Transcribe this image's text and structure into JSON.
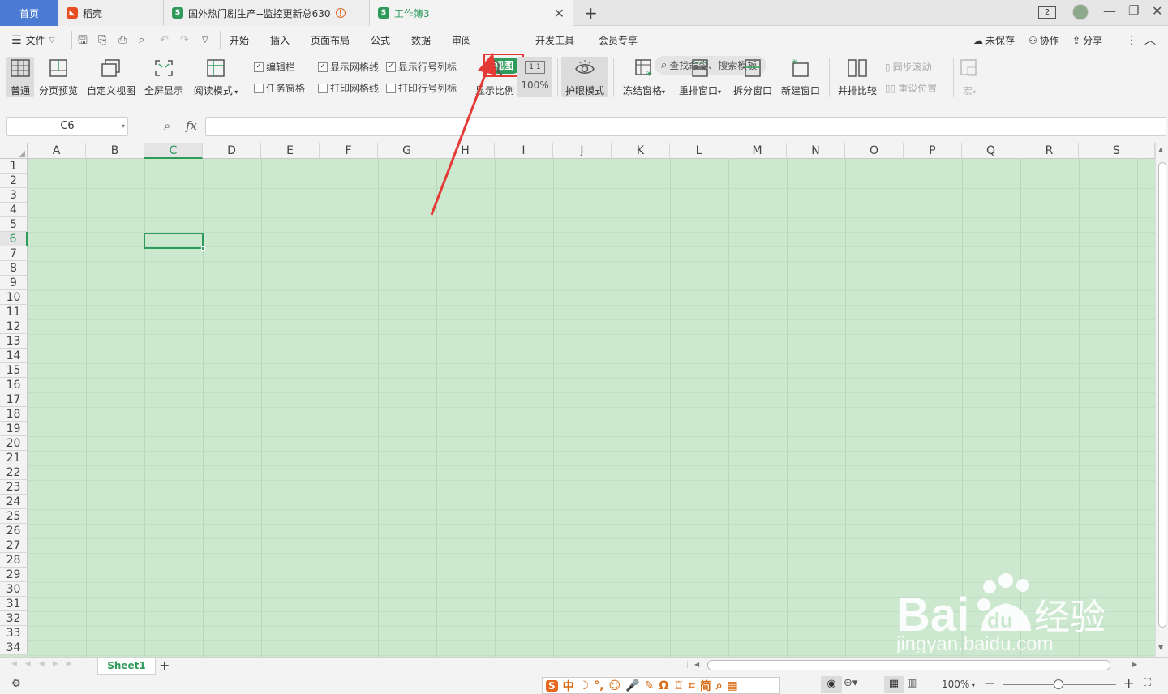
{
  "tabs": {
    "home": "首页",
    "daoke": "稻壳",
    "doc1": "国外热门剧生产--监控更新总630",
    "active": "工作簿3",
    "new_tab": "+"
  },
  "window": {
    "count_badge": "2"
  },
  "menu": {
    "file": "文件",
    "tabs": [
      "开始",
      "插入",
      "页面布局",
      "公式",
      "数据",
      "审阅",
      "视图",
      "开发工具",
      "会员专享"
    ],
    "search_placeholder": "查找命令、搜索模板",
    "unsaved": "未保存",
    "collab": "协作",
    "share": "分享"
  },
  "ribbon": {
    "normal": "普通",
    "page_break": "分页预览",
    "custom_view": "自定义视图",
    "full_screen": "全屏显示",
    "read_mode": "阅读模式",
    "edit_bar": "编辑栏",
    "task_pane": "任务窗格",
    "show_gridlines": "显示网格线",
    "print_gridlines": "打印网格线",
    "show_headers": "显示行号列标",
    "print_headers": "打印行号列标",
    "zoom": "显示比例",
    "zoom100": "100%",
    "zoom_icon": "1:1",
    "eye_mode": "护眼模式",
    "freeze": "冻结窗格",
    "arrange": "重排窗口",
    "split": "拆分窗口",
    "new_window": "新建窗口",
    "side_by_side": "并排比较",
    "sync_scroll": "同步滚动",
    "reset_pos": "重设位置",
    "macro": "宏"
  },
  "checks": {
    "edit_bar": true,
    "task_pane": false,
    "show_gridlines": true,
    "print_gridlines": false,
    "show_headers": true,
    "print_headers": false
  },
  "formula": {
    "name_box": "C6",
    "fx": "fx",
    "value": ""
  },
  "columns": [
    "A",
    "B",
    "C",
    "D",
    "E",
    "F",
    "G",
    "H",
    "I",
    "J",
    "K",
    "L",
    "M",
    "N",
    "O",
    "P",
    "Q",
    "R",
    "S"
  ],
  "rows": [
    "1",
    "2",
    "3",
    "4",
    "5",
    "6",
    "7",
    "8",
    "9",
    "10",
    "11",
    "12",
    "13",
    "14",
    "15",
    "16",
    "17",
    "18",
    "19",
    "20",
    "21",
    "22",
    "23",
    "24",
    "25",
    "26",
    "27",
    "28",
    "29",
    "30",
    "31",
    "32",
    "33",
    "34"
  ],
  "selected": {
    "col": "C",
    "row": "6"
  },
  "sheets": {
    "name": "Sheet1",
    "add": "+"
  },
  "status": {
    "zoom": "100%",
    "ime": [
      "中",
      "简"
    ]
  },
  "watermark": {
    "brand": "Bai经验",
    "url": "jingyan.baidu.com"
  },
  "colors": {
    "accent": "#2f9b5b",
    "eye_bg": "#cce8cf",
    "highlight_red": "#e53935",
    "home_tab": "#4b7bd3"
  }
}
